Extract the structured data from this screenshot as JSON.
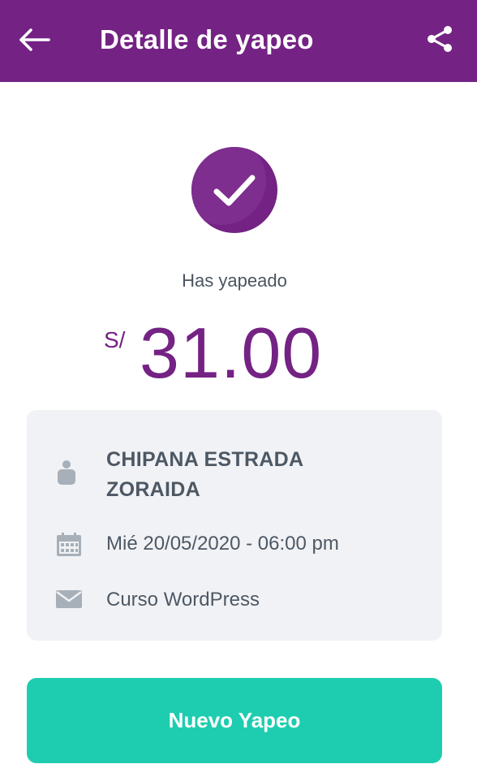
{
  "header": {
    "title": "Detalle de yapeo",
    "back_icon": "arrow-left-icon",
    "share_icon": "share-icon",
    "bg_color": "#742284"
  },
  "summary": {
    "status_icon": "check-circle-icon",
    "label": "Has yapeado",
    "currency": "S/",
    "amount": "31.00",
    "accent_color": "#742284"
  },
  "details": {
    "recipient_name": "CHIPANA ESTRADA ZORAIDA",
    "recipient_icon": "person-icon",
    "datetime": "Mié 20/05/2020 - 06:00 pm",
    "datetime_icon": "calendar-icon",
    "message": "Curso WordPress",
    "message_icon": "envelope-icon"
  },
  "actions": {
    "new_payment_label": "Nuevo Yapeo",
    "button_color": "#1ecdb0"
  }
}
